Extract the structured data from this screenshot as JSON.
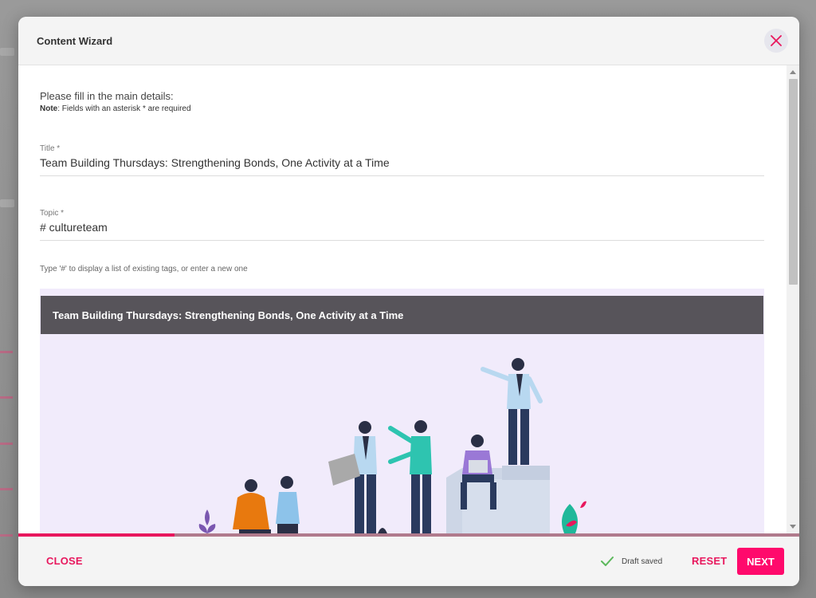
{
  "modal": {
    "title": "Content Wizard"
  },
  "intro": {
    "instruction": "Please fill in the main details:",
    "note_label": "Note",
    "note_text": ": Fields with an asterisk * are required"
  },
  "form": {
    "title_label": "Title *",
    "title_value": "Team Building Thursdays: Strengthening Bonds, One Activity at a Time",
    "topic_label": "Topic *",
    "topic_value": "# cultureteam",
    "topic_hint": "Type '#' to display a list of existing tags, or enter a new one"
  },
  "preview": {
    "title": "Team Building Thursdays: Strengthening Bonds, One Activity at a Time"
  },
  "progress": {
    "fraction": 0.2
  },
  "footer": {
    "close_label": "CLOSE",
    "draft_status": "Draft saved",
    "reset_label": "RESET",
    "next_label": "NEXT"
  },
  "colors": {
    "accent": "#e8175d",
    "next_button": "#ff0a6c",
    "preview_bg": "#f1ebfb",
    "preview_header": "#57545a",
    "check_green": "#5cb85c"
  },
  "icons": {
    "close": "close-icon",
    "draft": "check-icon"
  }
}
